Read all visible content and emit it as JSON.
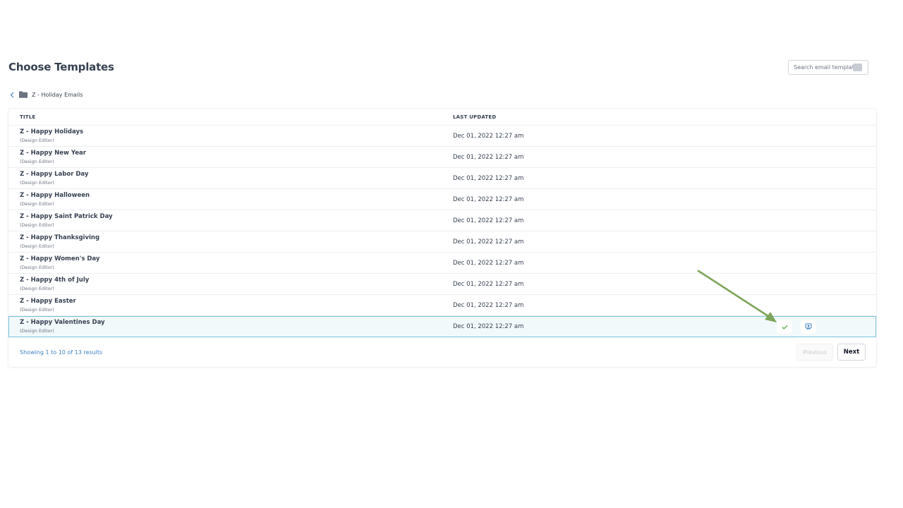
{
  "page": {
    "title": "Choose Templates"
  },
  "search": {
    "placeholder": "Search email template"
  },
  "breadcrumb": {
    "folder_label": "Z - Holiday Emails"
  },
  "table": {
    "columns": [
      "TITLE",
      "LAST UPDATED"
    ],
    "rows": [
      {
        "title": "Z - Happy Holidays",
        "subtitle": "(Design Editor)",
        "updated": "Dec 01, 2022 12:27 am"
      },
      {
        "title": "Z - Happy New Year",
        "subtitle": "(Design Editor)",
        "updated": "Dec 01, 2022 12:27 am"
      },
      {
        "title": "Z - Happy Labor Day",
        "subtitle": "(Design Editor)",
        "updated": "Dec 01, 2022 12:27 am"
      },
      {
        "title": "Z - Happy Halloween",
        "subtitle": "(Design Editor)",
        "updated": "Dec 01, 2022 12:27 am"
      },
      {
        "title": "Z - Happy Saint Patrick Day",
        "subtitle": "(Design Editor)",
        "updated": "Dec 01, 2022 12:27 am"
      },
      {
        "title": "Z - Happy Thanksgiving",
        "subtitle": "(Design Editor)",
        "updated": "Dec 01, 2022 12:27 am"
      },
      {
        "title": "Z - Happy Women's Day",
        "subtitle": "(Design Editor)",
        "updated": "Dec 01, 2022 12:27 am"
      },
      {
        "title": "Z - Happy 4th of July",
        "subtitle": "(Design Editor)",
        "updated": "Dec 01, 2022 12:27 am"
      },
      {
        "title": "Z - Happy Easter",
        "subtitle": "(Design Editor)",
        "updated": "Dec 01, 2022 12:27 am"
      },
      {
        "title": "Z - Happy Valentines Day",
        "subtitle": "(Design Editor)",
        "updated": "Dec 01, 2022 12:27 am"
      }
    ],
    "selected_row": 9
  },
  "row_actions": {
    "select_icon": "check-icon",
    "preview_icon": "preview-icon"
  },
  "pagination": {
    "results_text": "Showing 1 to 10 of 13 results",
    "previous_label": "Previous",
    "next_label": "Next"
  },
  "colors": {
    "accent_link": "#3b82c4",
    "selected_row_border": "#7cc3d8",
    "check_green": "#5aa845",
    "annotation_arrow": "#7da55a"
  }
}
